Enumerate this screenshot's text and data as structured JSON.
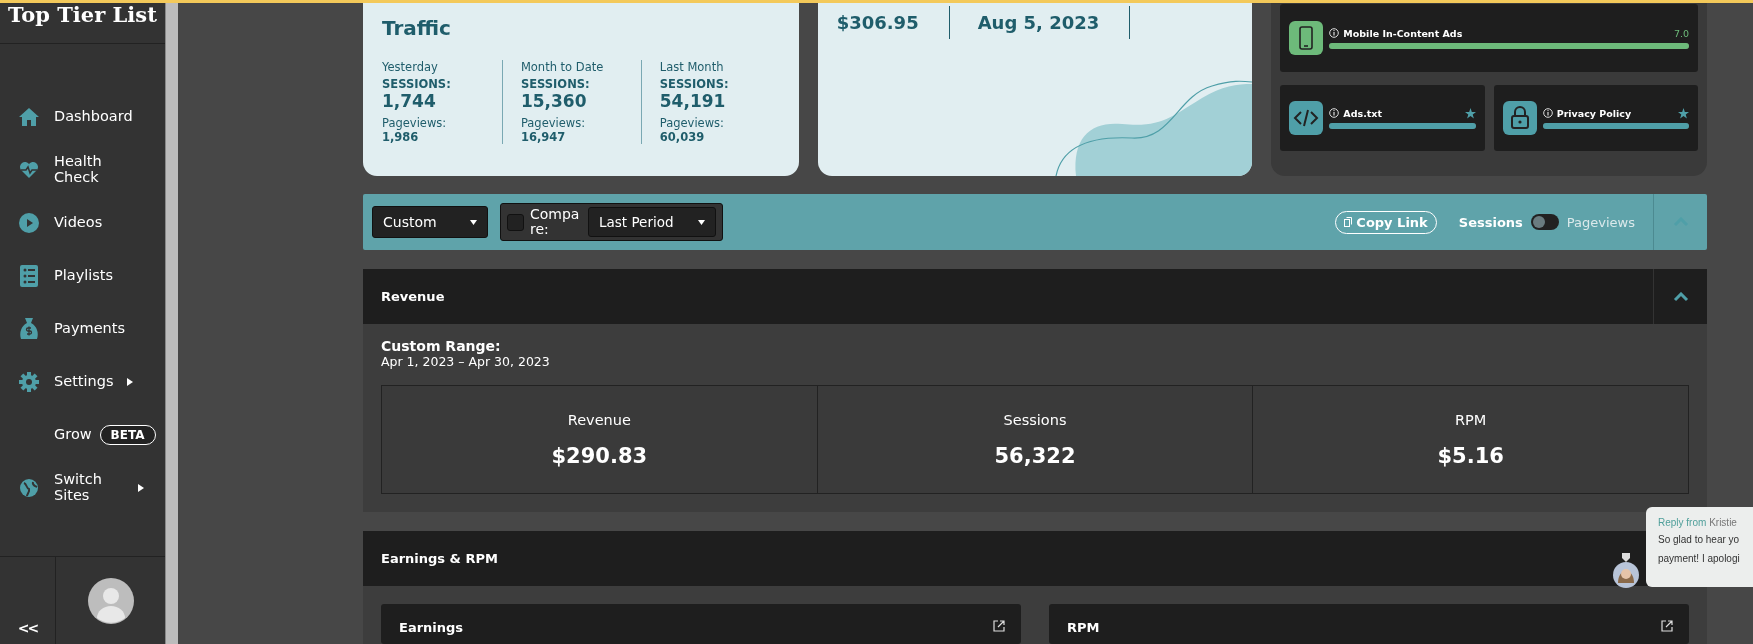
{
  "sidebar": {
    "brand": "Top Tier List",
    "items": [
      {
        "kind": "home",
        "label": "Dashboard",
        "submenu": false
      },
      {
        "kind": "heart",
        "label": "Health Check",
        "submenu": false
      },
      {
        "kind": "play",
        "label": "Videos",
        "submenu": false
      },
      {
        "kind": "list",
        "label": "Playlists",
        "submenu": false
      },
      {
        "kind": "money",
        "label": "Payments",
        "submenu": false
      },
      {
        "kind": "gear",
        "label": "Settings",
        "submenu": true
      },
      {
        "kind": "plain",
        "label": "Grow",
        "badge": "BETA",
        "submenu": false
      },
      {
        "kind": "globe",
        "label": "Switch Sites",
        "submenu": true
      }
    ],
    "collapse": "<<"
  },
  "traffic": {
    "title": "Traffic",
    "columns": [
      {
        "period": "Yesterday",
        "sessions_label": "SESSIONS:",
        "sessions": "1,744",
        "pageviews_label": "Pageviews:",
        "pageviews": "1,986"
      },
      {
        "period": "Month to Date",
        "sessions_label": "SESSIONS:",
        "sessions": "15,360",
        "pageviews_label": "Pageviews:",
        "pageviews": "16,947"
      },
      {
        "period": "Last Month",
        "sessions_label": "SESSIONS:",
        "sessions": "54,191",
        "pageviews_label": "Pageviews:",
        "pageviews": "60,039"
      }
    ]
  },
  "payment": {
    "values": [
      "$306.95",
      "Aug 5, 2023"
    ]
  },
  "health": [
    {
      "kind": "phone",
      "label": "Mobile In-Content Ads",
      "score": "7.0",
      "level": 1,
      "color": "#6dba7a",
      "starred": false,
      "wide": true
    },
    {
      "kind": "code",
      "label": "Ads.txt",
      "level": 1,
      "color": "#4f9fa8",
      "starred": true,
      "wide": false
    },
    {
      "kind": "lock",
      "label": "Privacy Policy",
      "level": 1,
      "color": "#4f9fa8",
      "starred": true,
      "wide": false
    }
  ],
  "filters": {
    "range": "Custom",
    "compare_label": "Compare:",
    "compare_checked": false,
    "compare_period": "Last Period",
    "copy_link": "Copy Link",
    "metric_toggle": [
      {
        "label": "Sessions",
        "selected": true
      },
      {
        "label": "Pageviews",
        "selected": false
      }
    ]
  },
  "revenue": {
    "title": "Revenue",
    "range_label": "Custom Range:",
    "range": "Apr 1, 2023 – Apr 30, 2023",
    "stats": [
      {
        "label": "Revenue",
        "value": "$290.83"
      },
      {
        "label": "Sessions",
        "value": "56,322"
      },
      {
        "label": "RPM",
        "value": "$5.16"
      }
    ]
  },
  "earnings": {
    "title": "Earnings & RPM",
    "cards": [
      "Earnings",
      "RPM"
    ]
  },
  "chat": {
    "from_label": "Reply from",
    "from_name": "Kristie",
    "lines": [
      "So glad to hear yo",
      "payment! I apologi"
    ]
  }
}
